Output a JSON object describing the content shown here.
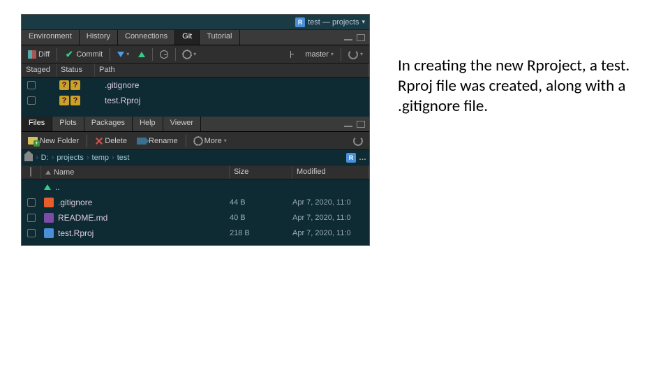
{
  "project": {
    "label": "test — projects"
  },
  "env_tabs": {
    "environment": "Environment",
    "history": "History",
    "connections": "Connections",
    "git": "Git",
    "tutorial": "Tutorial"
  },
  "git_toolbar": {
    "diff": "Diff",
    "commit": "Commit",
    "branch": "master"
  },
  "git_header": {
    "staged": "Staged",
    "status": "Status",
    "path": "Path"
  },
  "git_rows": [
    {
      "path": ".gitignore"
    },
    {
      "path": "test.Rproj"
    }
  ],
  "file_tabs": {
    "files": "Files",
    "plots": "Plots",
    "packages": "Packages",
    "help": "Help",
    "viewer": "Viewer"
  },
  "file_toolbar": {
    "newfolder": "New Folder",
    "delete": "Delete",
    "rename": "Rename",
    "more": "More"
  },
  "breadcrumb": {
    "c0": "D:",
    "c1": "projects",
    "c2": "temp",
    "c3": "test"
  },
  "file_header": {
    "name": "Name",
    "size": "Size",
    "modified": "Modified"
  },
  "files": {
    "up": "..",
    "r0_name": ".gitignore",
    "r0_size": "44 B",
    "r0_mod": "Apr 7, 2020, 11:0",
    "r1_name": "README.md",
    "r1_size": "40 B",
    "r1_mod": "Apr 7, 2020, 11:0",
    "r2_name": "test.Rproj",
    "r2_size": "218 B",
    "r2_mod": "Apr 7, 2020, 11:0"
  },
  "caption": "In creating the new Rproject, a test. Rproj file was created, along with a .gitignore file."
}
